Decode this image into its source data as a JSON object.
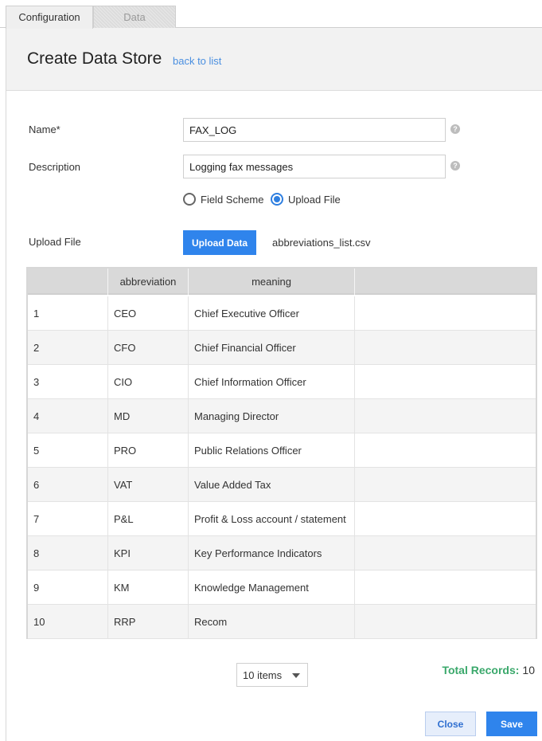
{
  "tabs": [
    {
      "label": "Configuration",
      "active": true
    },
    {
      "label": "Data",
      "active": false
    }
  ],
  "header": {
    "title": "Create Data Store",
    "back_link": "back to list"
  },
  "form": {
    "name_label": "Name*",
    "name_value": "FAX_LOG",
    "description_label": "Description",
    "description_value": "Logging fax messages",
    "help_icon": "question-circle-icon",
    "radio_field_scheme": "Field Scheme",
    "radio_upload_file": "Upload File",
    "selected_source": "Upload File",
    "upload_label": "Upload File",
    "upload_button": "Upload Data",
    "file_name": "abbreviations_list.csv"
  },
  "table": {
    "columns": [
      "",
      "abbreviation",
      "meaning",
      ""
    ],
    "rows": [
      [
        "1",
        "CEO",
        "Chief Executive Officer"
      ],
      [
        "2",
        "CFO",
        "Chief Financial Officer"
      ],
      [
        "3",
        "CIO",
        "Chief Information Officer"
      ],
      [
        "4",
        "MD",
        "Managing Director"
      ],
      [
        "5",
        "PRO",
        "Public Relations Officer"
      ],
      [
        "6",
        "VAT",
        "Value Added Tax"
      ],
      [
        "7",
        "P&L",
        "Profit & Loss account / statement"
      ],
      [
        "8",
        "KPI",
        "Key Performance Indicators"
      ],
      [
        "9",
        "KM",
        "Knowledge Management"
      ],
      [
        "10",
        "RRP",
        "Recom"
      ]
    ]
  },
  "pager": {
    "page_size": "10 items",
    "total_label": "Total Records:",
    "total_value": "10"
  },
  "footer": {
    "close": "Close",
    "save": "Save"
  },
  "colors": {
    "primary": "#2f84ec",
    "link": "#4a8fe0",
    "total_green": "#3aa86b"
  }
}
